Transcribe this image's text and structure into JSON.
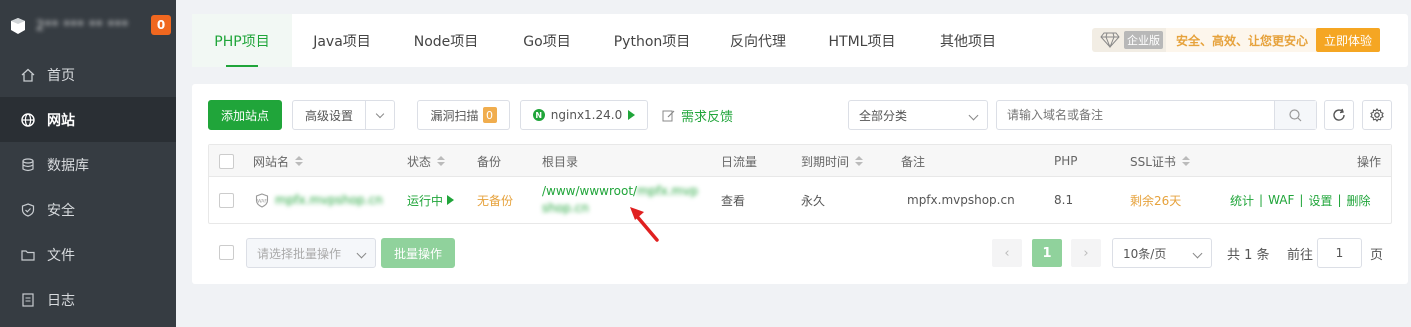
{
  "sidebar": {
    "server_name": "2** *** ** ***",
    "badge": "0",
    "items": [
      {
        "label": "首页",
        "icon": "home-icon"
      },
      {
        "label": "网站",
        "icon": "globe-icon",
        "active": true
      },
      {
        "label": "数据库",
        "icon": "database-icon"
      },
      {
        "label": "安全",
        "icon": "shield-icon"
      },
      {
        "label": "文件",
        "icon": "folder-icon"
      },
      {
        "label": "日志",
        "icon": "log-icon"
      }
    ]
  },
  "tabs": [
    "PHP项目",
    "Java项目",
    "Node项目",
    "Go项目",
    "Python项目",
    "反向代理",
    "HTML项目",
    "其他项目"
  ],
  "promo": {
    "edition": "企业版",
    "text": "安全、高效、让您更安心",
    "button": "立即体验"
  },
  "toolbar": {
    "add_site": "添加站点",
    "advanced": "高级设置",
    "vuln_scan": "漏洞扫描",
    "vuln_count": "0",
    "nginx": "nginx1.24.0",
    "feedback": "需求反馈",
    "category": "全部分类",
    "search_placeholder": "请输入域名或备注"
  },
  "table": {
    "headers": {
      "name": "网站名",
      "status": "状态",
      "backup": "备份",
      "root": "根目录",
      "traffic": "日流量",
      "expire": "到期时间",
      "remark": "备注",
      "php": "PHP",
      "ssl": "SSL证书",
      "ops": "操作"
    },
    "rows": [
      {
        "name": "mpfx.mvpshop.cn",
        "status": "运行中",
        "backup": "无备份",
        "root_prefix": "/www/wwwroot/",
        "root_blur1": "mpfx.mvp",
        "root_blur2": "shop.cn",
        "traffic": "查看",
        "expire": "永久",
        "remark": "mpfx.mvpshop.cn",
        "php": "8.1",
        "ssl": "剩余26天",
        "ops": [
          "统计",
          "WAF",
          "设置",
          "删除"
        ]
      }
    ]
  },
  "footer": {
    "batch_placeholder": "请选择批量操作",
    "batch_button": "批量操作",
    "current_page": "1",
    "page_size": "10条/页",
    "total": "共 1 条",
    "goto_label": "前往",
    "goto_value": "1",
    "page_suffix": "页"
  },
  "colors": {
    "accent": "#20a53a",
    "sidebar_bg": "#363c42",
    "warning": "#e6a23c"
  }
}
